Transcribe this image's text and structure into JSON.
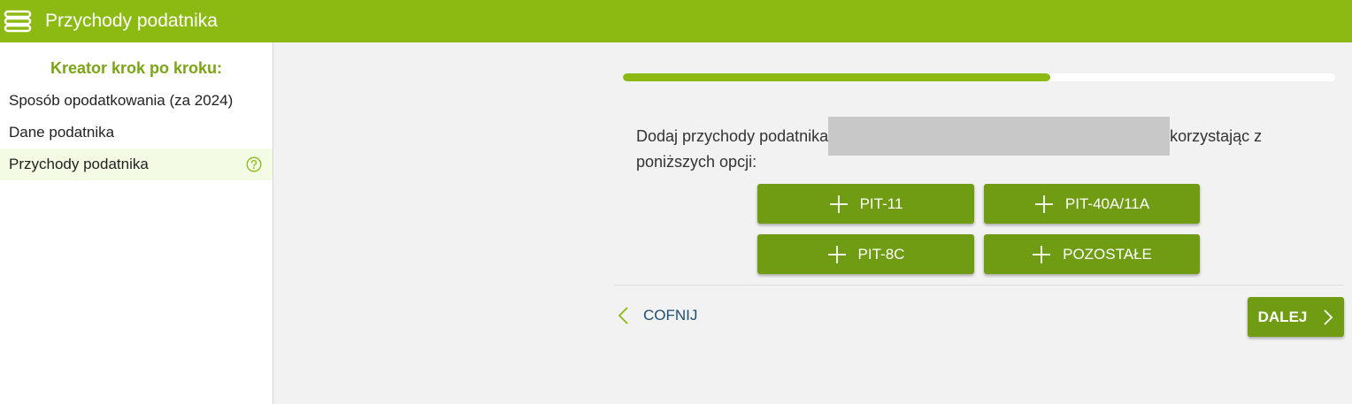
{
  "header": {
    "title": "Przychody podatnika",
    "menu_icon": "menu-icon"
  },
  "sidebar": {
    "heading": "Kreator krok po kroku:",
    "items": [
      {
        "label": "Sposób opodatkowania (za 2024)"
      },
      {
        "label": "Dane podatnika"
      },
      {
        "label": "Przychody podatnika",
        "active": true,
        "icon": "help-icon"
      }
    ]
  },
  "main": {
    "progress_fraction": 0.6,
    "prompt_before": "Dodaj przychody podatnika",
    "prompt_after": "korzystając z poniższych opcji:",
    "buttons": [
      {
        "label": "PIT-11",
        "icon": "plus-icon"
      },
      {
        "label": "PIT-40A/11A",
        "icon": "plus-icon"
      },
      {
        "label": "PIT-8C",
        "icon": "plus-icon"
      },
      {
        "label": "POZOSTAŁE",
        "icon": "plus-icon"
      }
    ],
    "back_label": "COFNIJ",
    "next_label": "DALEJ"
  },
  "colors": {
    "brand": "#8cba13",
    "button": "#6f9c12",
    "heading": "#7aa514",
    "link": "#1f4e6e"
  }
}
